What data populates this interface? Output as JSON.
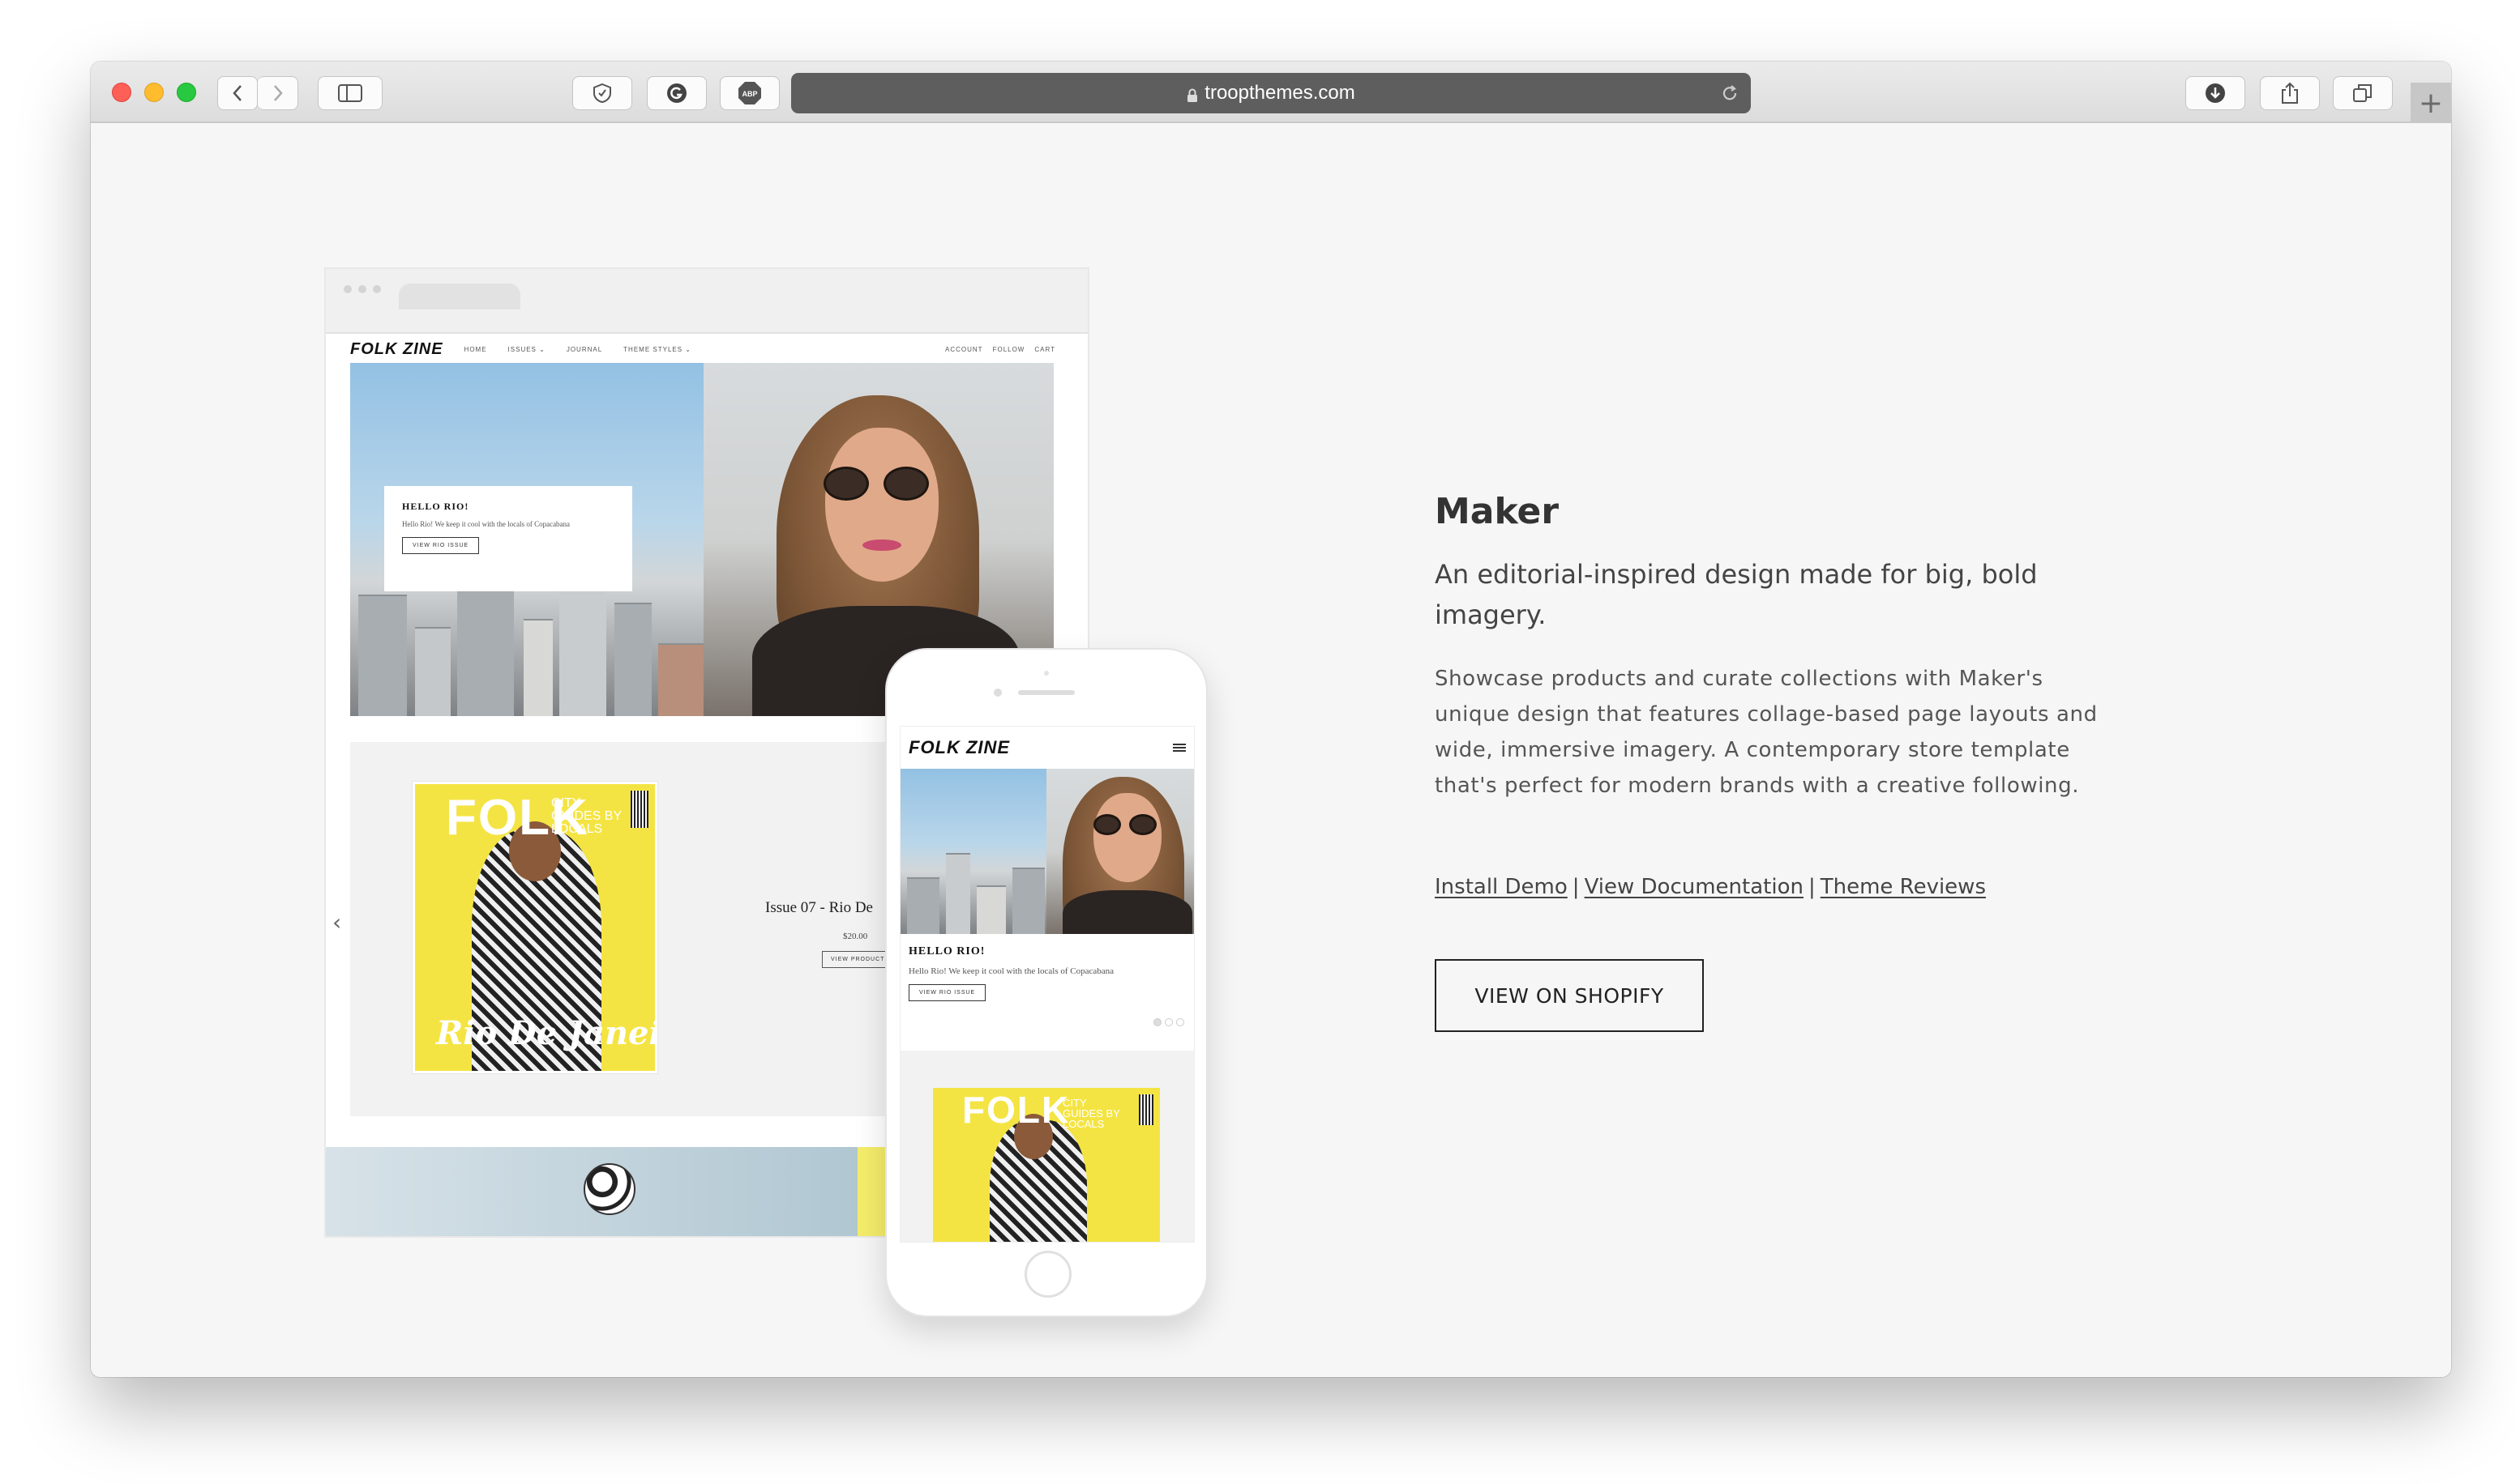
{
  "browser": {
    "url": "troopthemes.com",
    "traffic_lights": {
      "close": "#fe5f57",
      "minimize": "#febc2e",
      "zoom": "#28c840"
    },
    "new_tab_label": "+"
  },
  "desktop_preview": {
    "logo": "FOLK ZINE",
    "nav_left": [
      "HOME",
      "ISSUES ⌄",
      "JOURNAL",
      "THEME STYLES ⌄"
    ],
    "nav_right": [
      "ACCOUNT",
      "FOLLOW",
      "CART"
    ],
    "hero": {
      "heading": "HELLO RIO!",
      "text": "Hello Rio! We keep it cool with the locals of Copacabana",
      "button": "VIEW RIO ISSUE"
    },
    "product": {
      "cover_title": "FOLK",
      "cover_subtitle": "CITY GUIDES BY LOCALS",
      "cover_script": "Rio De Janeiro",
      "title": "Issue 07 - Rio De",
      "price": "$20.00",
      "button": "VIEW PRODUCT"
    }
  },
  "mobile_preview": {
    "logo": "FOLK ZINE",
    "hero": {
      "heading": "HELLO RIO!",
      "text": "Hello Rio! We keep it cool with the locals of Copacabana",
      "button": "VIEW RIO ISSUE"
    },
    "cover_title": "FOLK",
    "cover_subtitle": "CITY GUIDES BY LOCALS"
  },
  "theme": {
    "name": "Maker",
    "tagline": "An editorial-inspired design made for big, bold imagery.",
    "description": "Showcase products and curate collections with Maker's unique design that features collage-based page layouts and wide, immersive imagery. A contemporary store template that's perfect for modern brands with a creative following.",
    "links": [
      "Install Demo",
      "View Documentation",
      "Theme Reviews"
    ],
    "separator": "|",
    "cta": "VIEW ON SHOPIFY"
  }
}
